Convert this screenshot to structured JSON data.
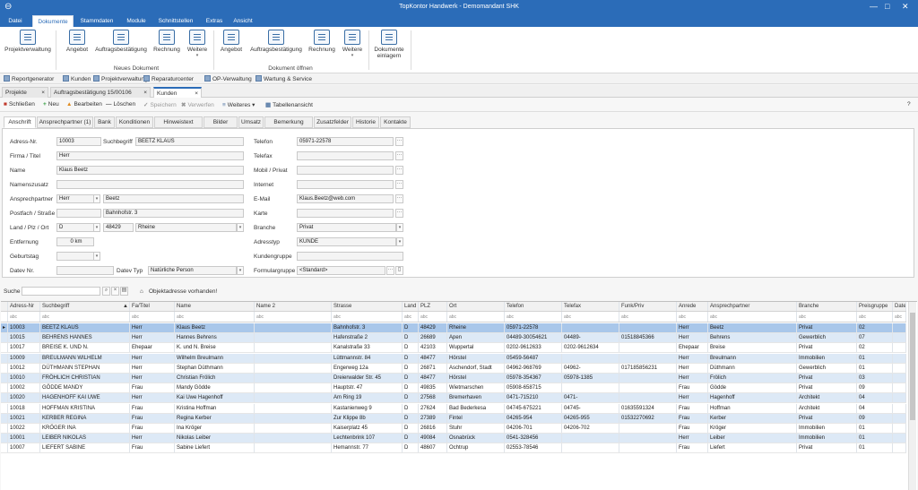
{
  "window": {
    "title": "TopKontor Handwerk - Demomandant SHK",
    "minimize": "—",
    "maximize": "□",
    "close": "✕",
    "app_icon": "⊖"
  },
  "ribbon_tabs": [
    "Datei",
    "Dokumente",
    "Stammdaten",
    "Module",
    "Schnittstellen",
    "Extras",
    "Ansicht"
  ],
  "ribbon": {
    "buttons": [
      {
        "label": "Projektverwaltung",
        "icon": "project-icon"
      },
      {
        "label": "Angebot",
        "icon": "offer-icon"
      },
      {
        "label": "Auftragsbestätigung",
        "icon": "order-confirmation-icon"
      },
      {
        "label": "Rechnung",
        "icon": "invoice-icon"
      },
      {
        "label": "Weitere",
        "icon": "more-icon"
      },
      {
        "label": "Angebot",
        "icon": "open-offer-icon"
      },
      {
        "label": "Auftragsbestätigung",
        "icon": "open-order-confirmation-icon"
      },
      {
        "label": "Rechnung",
        "icon": "open-invoice-icon"
      },
      {
        "label": "Weitere",
        "icon": "open-more-icon"
      },
      {
        "label": "Dokumente",
        "label2": "einlagern",
        "icon": "archive-icon"
      }
    ],
    "group_new": "Neues Dokument",
    "group_open": "Dokument öffnen"
  },
  "quickbar": [
    "Reportgenerator",
    "Kunden",
    "Projektverwaltung",
    "Reparaturcenter",
    "OP-Verwaltung",
    "Wartung & Service"
  ],
  "doc_tabs": [
    "Projekte",
    "Auftragsbestätigung 15/00106",
    "Kunden"
  ],
  "toolbar": {
    "close": "Schließen",
    "new": "Neu",
    "edit": "Bearbeiten",
    "delete": "Löschen",
    "save": "Speichern",
    "discard": "Verwerfen",
    "more": "Weiteres",
    "table_view": "Tabellenansicht"
  },
  "form_tabs": [
    "Anschrift",
    "Ansprechpartner (1)",
    "Bank",
    "Konditionen",
    "Hinweistext",
    "Bilder",
    "Umsatz",
    "Bemerkung",
    "Zusatzfelder",
    "Historie",
    "Kontakte"
  ],
  "form": {
    "labels": {
      "adress_nr": "Adress-Nr.",
      "suchbegriff": "Suchbegriff",
      "firma": "Firma / Titel",
      "name": "Name",
      "namenszusatz": "Namenszusatz",
      "ansprechpartner": "Ansprechpartner",
      "postfach": "Postfach / Straße",
      "land": "Land / Plz / Ort",
      "entfernung": "Entfernung",
      "geburtstag": "Geburtstag",
      "datev": "Datev Nr.",
      "datev_typ": "Datev Typ",
      "telefon": "Telefon",
      "telefax": "Telefax",
      "mobil": "Mobil / Privat",
      "internet": "Internet",
      "email": "E-Mail",
      "karte": "Karte",
      "branche": "Branche",
      "adresstyp": "Adresstyp",
      "kundengruppe": "Kundengruppe",
      "formulargruppe": "Formulargruppe"
    },
    "values": {
      "adress_nr": "10003",
      "suchbegriff": "BEETZ KLAUS",
      "firma": "Herr",
      "name": "Klaus Beetz",
      "namenszusatz": "",
      "anrede": "Herr",
      "ansprechpartner": "Beetz",
      "postfach": "",
      "strasse": "Bahnhofstr. 3",
      "land": "D",
      "plz": "48429",
      "ort": "Rheine",
      "entfernung": "0 km",
      "geburtstag": "",
      "datev": "",
      "datev_typ": "Natürliche Person",
      "telefon": "05971-22578",
      "telefax": "",
      "mobil": "",
      "internet": "",
      "email": "Klaus.Beetz@web.com",
      "karte": "",
      "branche": "Privat",
      "adresstyp": "KUNDE",
      "kundengruppe": "",
      "formulargruppe": "<Standard>"
    }
  },
  "search": {
    "label": "Suche",
    "value": "",
    "object_address": "Objektadresse vorhanden!"
  },
  "grid": {
    "columns": [
      "Adress-Nr",
      "Suchbegriff",
      "Fa/Titel",
      "Name",
      "Name 2",
      "Strasse",
      "Land",
      "PLZ",
      "Ort",
      "Telefon",
      "Telefax",
      "Funk/Priv",
      "Anrede",
      "Ansprechpartner",
      "Branche",
      "Preisgruppe",
      "Datev"
    ],
    "filter_placeholder": "abc",
    "rows": [
      [
        "10003",
        "BEETZ KLAUS",
        "Herr",
        "Klaus Beetz",
        "",
        "Bahnhofstr. 3",
        "D",
        "48429",
        "Rheine",
        "05971-22578",
        "",
        "",
        "Herr",
        "Beetz",
        "Privat",
        "02",
        ""
      ],
      [
        "10015",
        "BEHRENS HANNES",
        "Herr",
        "Hannes Behrens",
        "",
        "Hafenstraße 2",
        "D",
        "26689",
        "Apen",
        "04489-30054621",
        "04489-",
        "01518845366",
        "Herr",
        "Behrens",
        "Gewerblich",
        "07",
        ""
      ],
      [
        "10017",
        "BREISE K. UND N.",
        "Ehepaar",
        "K. und N. Breise",
        "",
        "Kanalstraße 33",
        "D",
        "42103",
        "Wuppertal",
        "0202-9612633",
        "0202-9612634",
        "",
        "Ehepaar",
        "Breise",
        "Privat",
        "02",
        ""
      ],
      [
        "10009",
        "BREULMANN WILHELM",
        "Herr",
        "Wilhelm Breulmann",
        "",
        "Lüttmannstr. 84",
        "D",
        "48477",
        "Hörstel",
        "05459-56487",
        "",
        "",
        "Herr",
        "Breulmann",
        "Immobilien",
        "01",
        ""
      ],
      [
        "10012",
        "DÜTHMANN STEPHAN",
        "Herr",
        "Stephan Düthmann",
        "",
        "Engerweg 12a",
        "D",
        "26871",
        "Aschendorf, Stadt",
        "04962-968769",
        "04962-",
        "017185856231",
        "Herr",
        "Düthmann",
        "Gewerblich",
        "01",
        ""
      ],
      [
        "10010",
        "FRÖHLICH CHRISTIAN",
        "Herr",
        "Christian Frölich",
        "",
        "Dreierwalder Str. 45",
        "D",
        "48477",
        "Hörstel",
        "05978-354367",
        "05978-1385",
        "",
        "Herr",
        "Frölich",
        "Privat",
        "03",
        ""
      ],
      [
        "10002",
        "GÖDDE MANDY",
        "Frau",
        "Mandy Gödde",
        "",
        "Hauptstr. 47",
        "D",
        "49835",
        "Wietmarschen",
        "05908-658715",
        "",
        "",
        "Frau",
        "Gödde",
        "Privat",
        "09",
        ""
      ],
      [
        "10020",
        "HAGENHOFF KAI UWE",
        "Herr",
        "Kai Uwe Hagenhoff",
        "",
        "Am Ring 19",
        "D",
        "27568",
        "Bremerhaven",
        "0471-715210",
        "0471-",
        "",
        "Herr",
        "Hagenhoff",
        "Architekt",
        "04",
        ""
      ],
      [
        "10018",
        "HOFFMAN KRISTINA",
        "Frau",
        "Kristina Hoffman",
        "",
        "Kastanienweg 9",
        "D",
        "27624",
        "Bad Bederkesa",
        "04745-675221",
        "04745-",
        "01635591324",
        "Frau",
        "Hoffman",
        "Architekt",
        "04",
        ""
      ],
      [
        "10021",
        "KERBER REGINA",
        "Frau",
        "Regina Kerber",
        "",
        "Zur Klippe 8b",
        "D",
        "27389",
        "Fintel",
        "04265-954",
        "04265-955",
        "01532270692",
        "Frau",
        "Kerber",
        "Privat",
        "09",
        ""
      ],
      [
        "10022",
        "KRÖGER INA",
        "Frau",
        "Ina Kröger",
        "",
        "Kaiserplatz 45",
        "D",
        "26816",
        "Stuhr",
        "04206-701",
        "04206-702",
        "",
        "Frau",
        "Kröger",
        "Immobilien",
        "01",
        ""
      ],
      [
        "10001",
        "LEIBER NIKOLAS",
        "Herr",
        "Nikolas Leiber",
        "",
        "Lechtenbrink 107",
        "D",
        "49084",
        "Osnabrück",
        "0541-328456",
        "",
        "",
        "Herr",
        "Leiber",
        "Immobilien",
        "01",
        ""
      ],
      [
        "10007",
        "LIEFERT SABINE",
        "Frau",
        "Sabine Liefert",
        "",
        "Hemannstr. 77",
        "D",
        "48607",
        "Ochtrup",
        "02553-78546",
        "",
        "",
        "Frau",
        "Liefert",
        "Privat",
        "01",
        ""
      ]
    ]
  },
  "icons": {
    "accent": "#2b6cb8",
    "selected_row": "#a9c7ea",
    "alt_row": "#dde9f6"
  }
}
